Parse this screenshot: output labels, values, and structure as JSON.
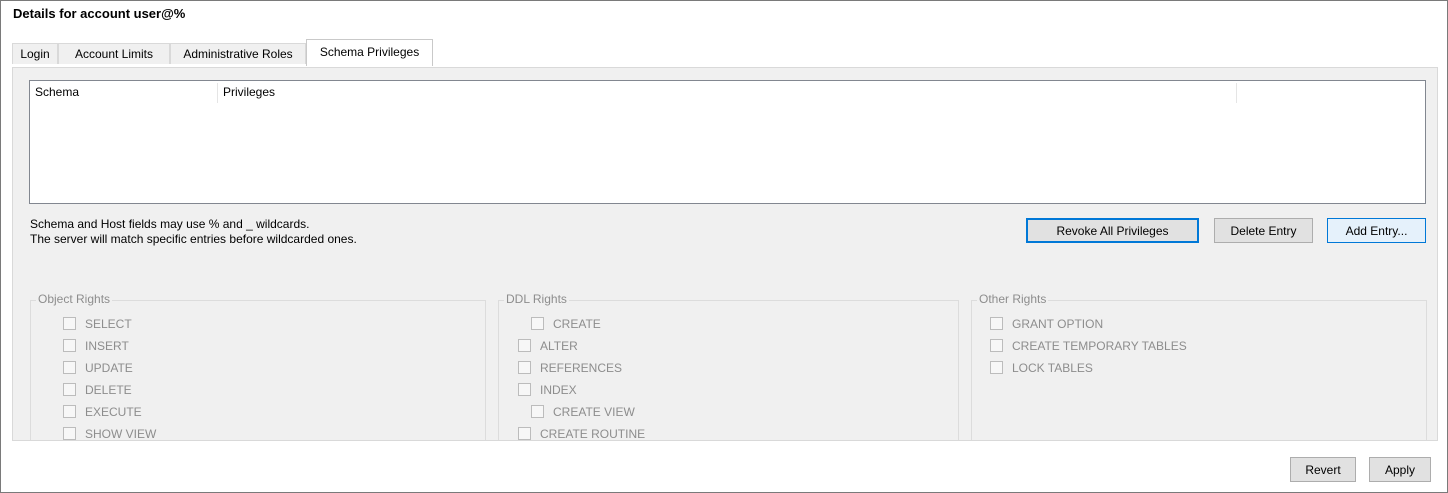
{
  "title": "Details for account user@%",
  "tabs": [
    {
      "label": "Login"
    },
    {
      "label": "Account Limits"
    },
    {
      "label": "Administrative Roles"
    },
    {
      "label": "Schema Privileges",
      "active": true
    }
  ],
  "grid": {
    "columns": [
      "Schema",
      "Privileges"
    ],
    "rows": []
  },
  "notes": [
    "Schema and Host fields may use % and _ wildcards.",
    "The server will match specific entries before wildcarded ones."
  ],
  "actions": {
    "revoke_all": "Revoke All Privileges",
    "delete_entry": "Delete Entry",
    "add_entry": "Add Entry..."
  },
  "groups": {
    "object_rights": {
      "label": "Object Rights",
      "items": [
        "SELECT",
        "INSERT",
        "UPDATE",
        "DELETE",
        "EXECUTE",
        "SHOW VIEW"
      ]
    },
    "ddl_rights": {
      "label": "DDL Rights",
      "items": [
        "CREATE",
        "ALTER",
        "REFERENCES",
        "INDEX",
        "CREATE VIEW",
        "CREATE ROUTINE"
      ]
    },
    "other_rights": {
      "label": "Other Rights",
      "items": [
        "GRANT OPTION",
        "CREATE TEMPORARY TABLES",
        "LOCK TABLES"
      ]
    }
  },
  "footer": {
    "revert": "Revert",
    "apply": "Apply"
  },
  "colors": {
    "accent": "#0078d7",
    "disabled_text": "#8d8d8d",
    "panel_bg": "#f0f0f0"
  }
}
